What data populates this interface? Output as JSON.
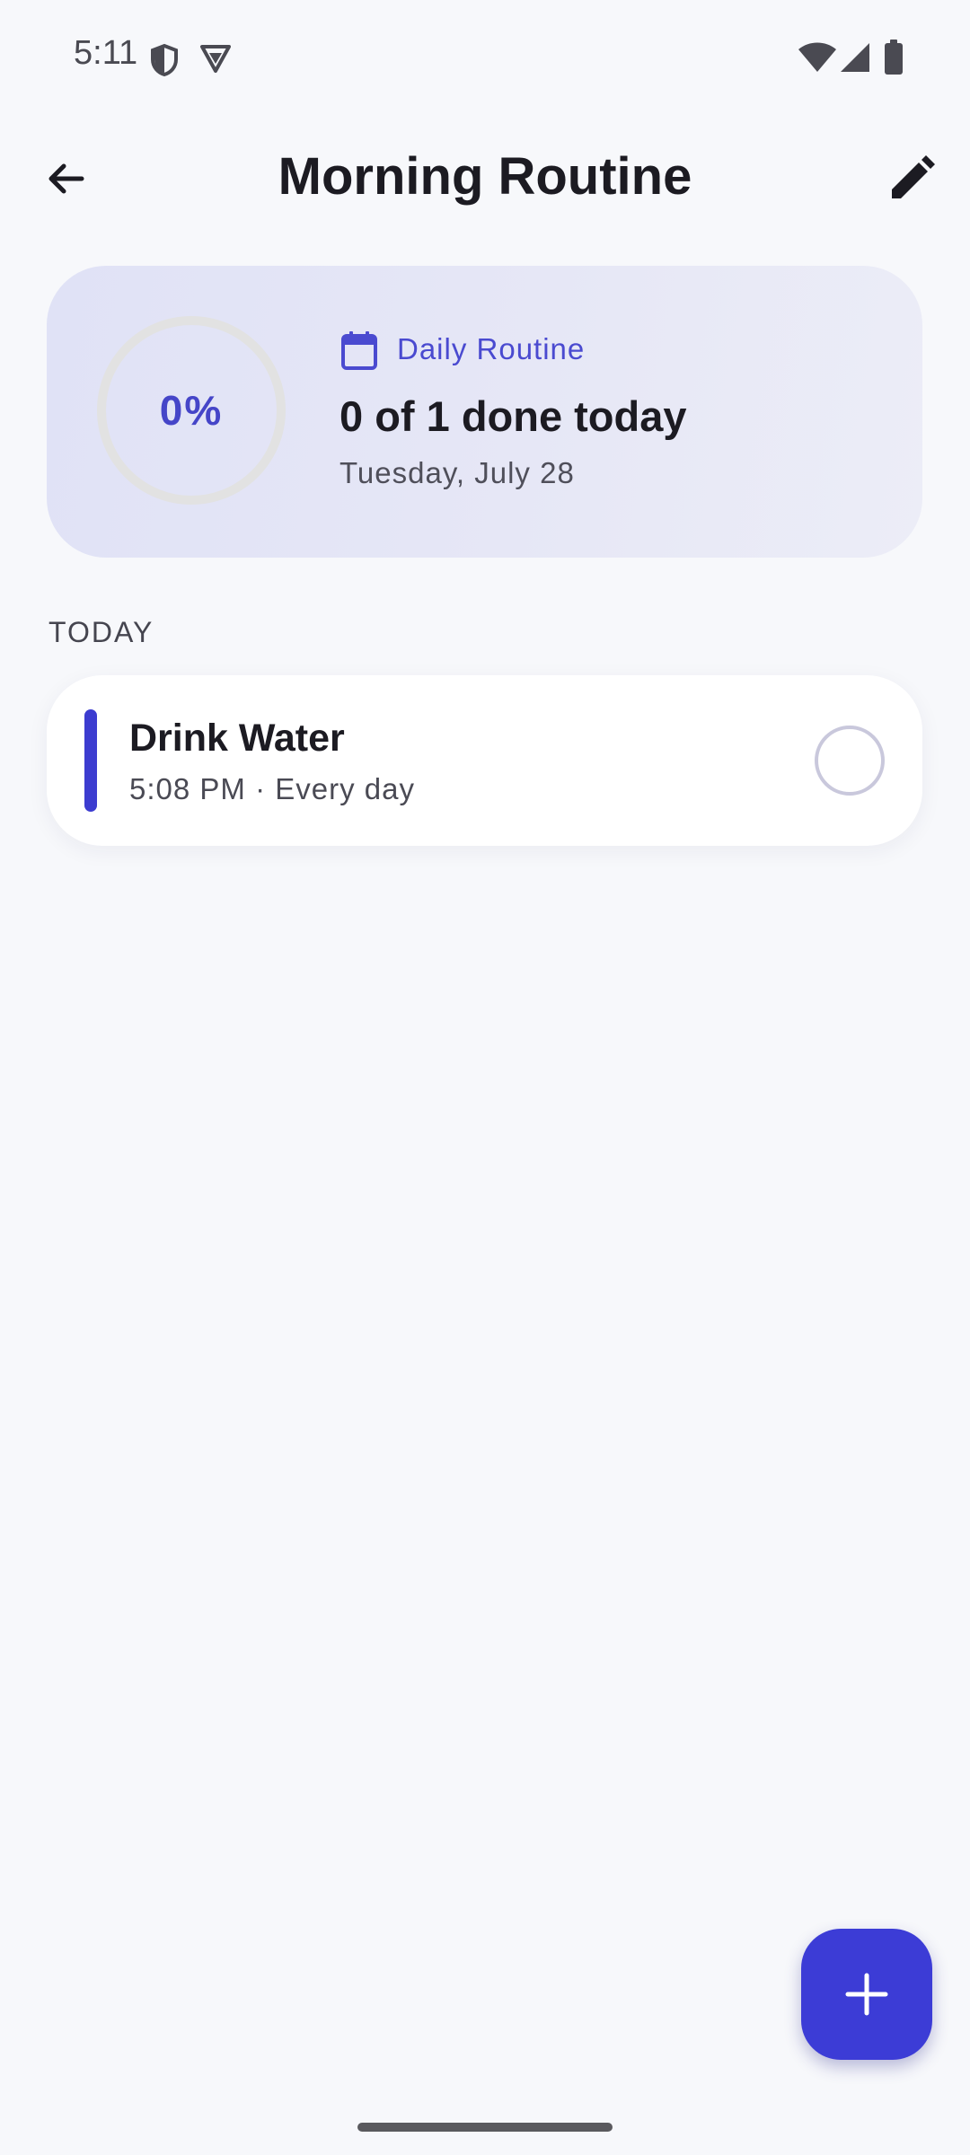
{
  "status_bar": {
    "time": "5:11",
    "icons": [
      "shield-icon",
      "vpn-icon",
      "wifi-icon",
      "signal-icon",
      "battery-icon"
    ]
  },
  "app_bar": {
    "title": "Morning Routine",
    "back_icon": "arrow-back-icon",
    "edit_icon": "pencil-edit-icon"
  },
  "summary": {
    "progress_percent": 0,
    "progress_label": "0%",
    "routine_type": "Daily Routine",
    "done_text": "0 of 1 done today",
    "date": "Tuesday, July 28"
  },
  "section": {
    "label": "TODAY"
  },
  "tasks": [
    {
      "title": "Drink Water",
      "subtitle": "5:08 PM · Every day",
      "completed": false,
      "accent_color": "#3c3cd0"
    }
  ],
  "fab": {
    "icon": "plus-icon"
  },
  "colors": {
    "accent": "#3c3cd6",
    "background": "#f7f8fb",
    "card_tint": "#e3e4f6"
  }
}
